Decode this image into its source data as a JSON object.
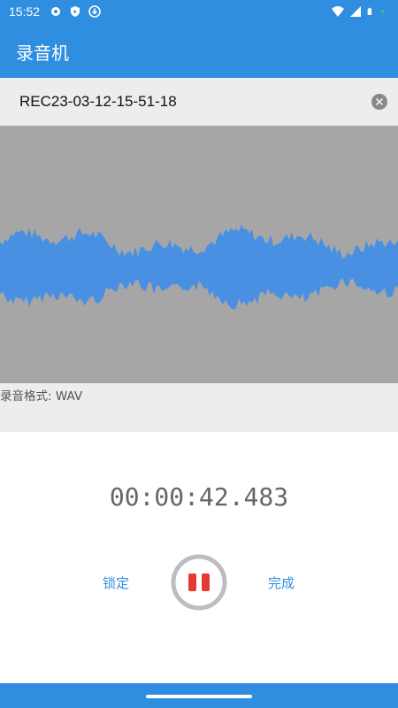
{
  "status_bar": {
    "time": "15:52",
    "left_icons": [
      "settings-icon",
      "shield-icon",
      "download-icon"
    ],
    "right_icons": [
      "wifi-icon",
      "signal-icon",
      "battery-icon",
      "dot-icon"
    ]
  },
  "app_bar": {
    "title": "录音机"
  },
  "recording": {
    "file_name": "REC23-03-12-15-51-18",
    "clear_icon": "clear-circle-icon",
    "format_label": "录音格式: WAV",
    "timer": "00:00:42.483"
  },
  "controls": {
    "lock_label": "锁定",
    "done_label": "完成",
    "pause_icon": "pause-icon"
  },
  "colors": {
    "primary": "#2f8ee0",
    "waveform": "#4a90e2",
    "waveform_bg": "#a6a6a6",
    "pause_accent": "#e53935",
    "pause_ring": "#bdbdbd"
  }
}
